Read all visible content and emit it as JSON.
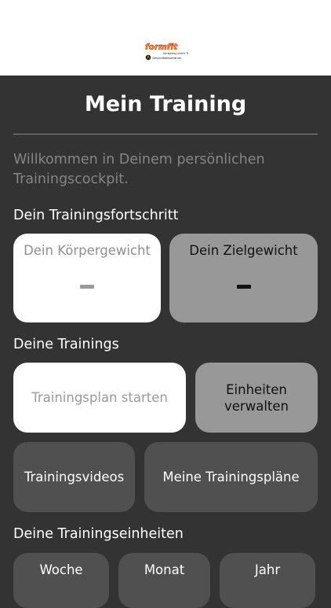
{
  "header": {
    "logo_text": "formfit",
    "logo_subtext": "Vorsprung durch Training",
    "logo_tagline": "Gesundheitszentrum",
    "logo_colors": {
      "main": "#e8aa10",
      "outline": "#c2181b",
      "dark": "#111111"
    }
  },
  "page": {
    "title": "Mein Training",
    "welcome": "Willkommen in Deinem persönlichen Trainingscockpit."
  },
  "progress": {
    "heading": "Dein Trainingsfortschritt",
    "body_weight": {
      "label": "Dein Körpergewicht",
      "value": "-"
    },
    "target_weight": {
      "label": "Dein Zielgewicht",
      "value": "-"
    }
  },
  "trainings": {
    "heading": "Deine Trainings",
    "start_plan": "Trainingsplan starten",
    "manage_units": "Einheiten verwalten",
    "videos": "Trainingsvideos",
    "my_plans": "Meine Trainingspläne"
  },
  "units": {
    "heading": "Deine Trainingseinheiten",
    "tabs": [
      "Woche",
      "Monat",
      "Jahr"
    ]
  },
  "colors": {
    "background": "#333333",
    "white_card": "#ffffff",
    "light_gray_card": "#989898",
    "dark_gray_card": "#505050",
    "muted_text": "#858585"
  }
}
